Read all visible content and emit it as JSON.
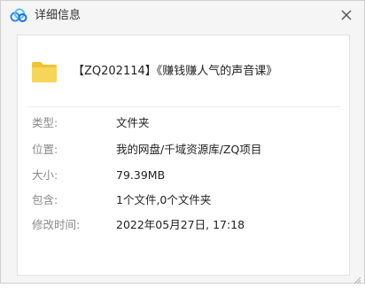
{
  "window": {
    "title": "详细信息",
    "icons": {
      "app": "cloud-icon",
      "close": "close-icon"
    }
  },
  "file": {
    "name": "【ZQ202114】《赚钱赚人气的声音课》",
    "icon": "folder-icon",
    "icon_color": "#f7cf4a"
  },
  "details": {
    "type": {
      "label": "类型:",
      "value": "文件夹"
    },
    "location": {
      "label": "位置:",
      "value": "我的网盘/千域资源库/ZQ项目"
    },
    "size": {
      "label": "大小:",
      "value": "79.39MB"
    },
    "contains": {
      "label": "包含:",
      "value": "1个文件,0个文件夹"
    },
    "modified": {
      "label": "修改时间:",
      "value": "2022年05月27日, 17:18"
    }
  },
  "colors": {
    "accent": "#2b8af7",
    "label_text": "#8a8a8a",
    "value_text": "#222222",
    "window_bg": "#f5f5f5",
    "panel_bg": "#ffffff"
  }
}
